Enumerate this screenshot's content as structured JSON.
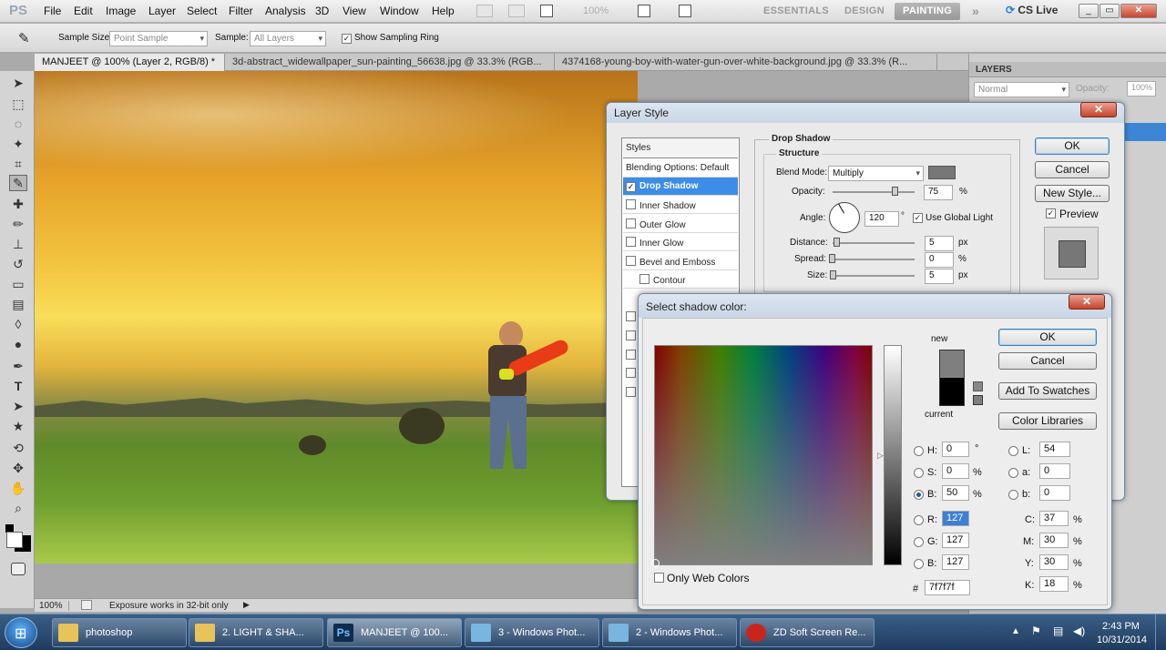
{
  "app": {
    "logo": "PS"
  },
  "menu": [
    "File",
    "Edit",
    "Image",
    "Layer",
    "Select",
    "Filter",
    "Analysis",
    "3D",
    "View",
    "Window",
    "Help"
  ],
  "zoom_menu": "100%",
  "workspaces": {
    "essentials": "ESSENTIALS",
    "design": "DESIGN",
    "painting": "PAINTING",
    "more": "»"
  },
  "cslive": "CS Live",
  "options_bar": {
    "sample_size_label": "Sample Size:",
    "sample_size_value": "Point Sample",
    "sample_label": "Sample:",
    "sample_value": "All Layers",
    "show_ring_label": "Show Sampling Ring"
  },
  "tabs": [
    "MANJEET @ 100% (Layer 2, RGB/8) *",
    "3d-abstract_widewallpaper_sun-painting_56638.jpg @ 33.3% (RGB...",
    "4374168-young-boy-with-water-gun-over-white-background.jpg @ 33.3% (R..."
  ],
  "status": {
    "zoom": "100%",
    "message": "Exposure works in 32-bit only"
  },
  "layers_panel": {
    "title": "LAYERS",
    "mode": "Normal",
    "opacity_label": "Opacity:",
    "opacity_value": "100%"
  },
  "layer_style": {
    "title": "Layer Style",
    "styles_header": "Styles",
    "items": [
      "Blending Options: Default",
      "Drop Shadow",
      "Inner Shadow",
      "Outer Glow",
      "Inner Glow",
      "Bevel and Emboss",
      "Contour"
    ],
    "section": "Drop Shadow",
    "subsection": "Structure",
    "blend_mode_label": "Blend Mode:",
    "blend_mode_value": "Multiply",
    "opacity_label": "Opacity:",
    "opacity_value": "75",
    "angle_label": "Angle:",
    "angle_value": "120",
    "angle_unit": "°",
    "global_light_label": "Use Global Light",
    "distance_label": "Distance:",
    "distance_value": "5",
    "spread_label": "Spread:",
    "spread_value": "0",
    "size_label": "Size:",
    "size_value": "5",
    "unit_px": "px",
    "unit_pct": "%",
    "ok": "OK",
    "cancel": "Cancel",
    "new_style": "New Style...",
    "preview": "Preview",
    "shadow_color": "#777777",
    "opacity_level": 0.75
  },
  "color_picker": {
    "title": "Select shadow color:",
    "new_label": "new",
    "current_label": "current",
    "new_color": "#7f7f7f",
    "current_color": "#000000",
    "ok": "OK",
    "cancel": "Cancel",
    "add_swatches": "Add To Swatches",
    "color_libraries": "Color Libraries",
    "fields": {
      "H": "0",
      "S": "0",
      "B": "50",
      "R": "127",
      "G": "127",
      "Bl": "127",
      "L": "54",
      "a": "0",
      "b": "0",
      "C": "37",
      "M": "30",
      "Y": "30",
      "K": "18"
    },
    "labels": {
      "H": "H:",
      "S": "S:",
      "B": "B:",
      "R": "R:",
      "G": "G:",
      "Bl": "B:",
      "L": "L:",
      "a": "a:",
      "b": "b:",
      "C": "C:",
      "M": "M:",
      "Y": "Y:",
      "K": "K:"
    },
    "units": {
      "deg": "°",
      "pct": "%"
    },
    "hex_label": "#",
    "hex": "7f7f7f",
    "web_only": "Only Web Colors"
  },
  "taskbar": {
    "items": [
      "photoshop",
      "2.  LIGHT & SHA...",
      "MANJEET @ 100...",
      "3 - Windows Phot...",
      "2 - Windows Phot...",
      "ZD Soft Screen Re..."
    ],
    "time": "2:43 PM",
    "date": "10/31/2014"
  }
}
